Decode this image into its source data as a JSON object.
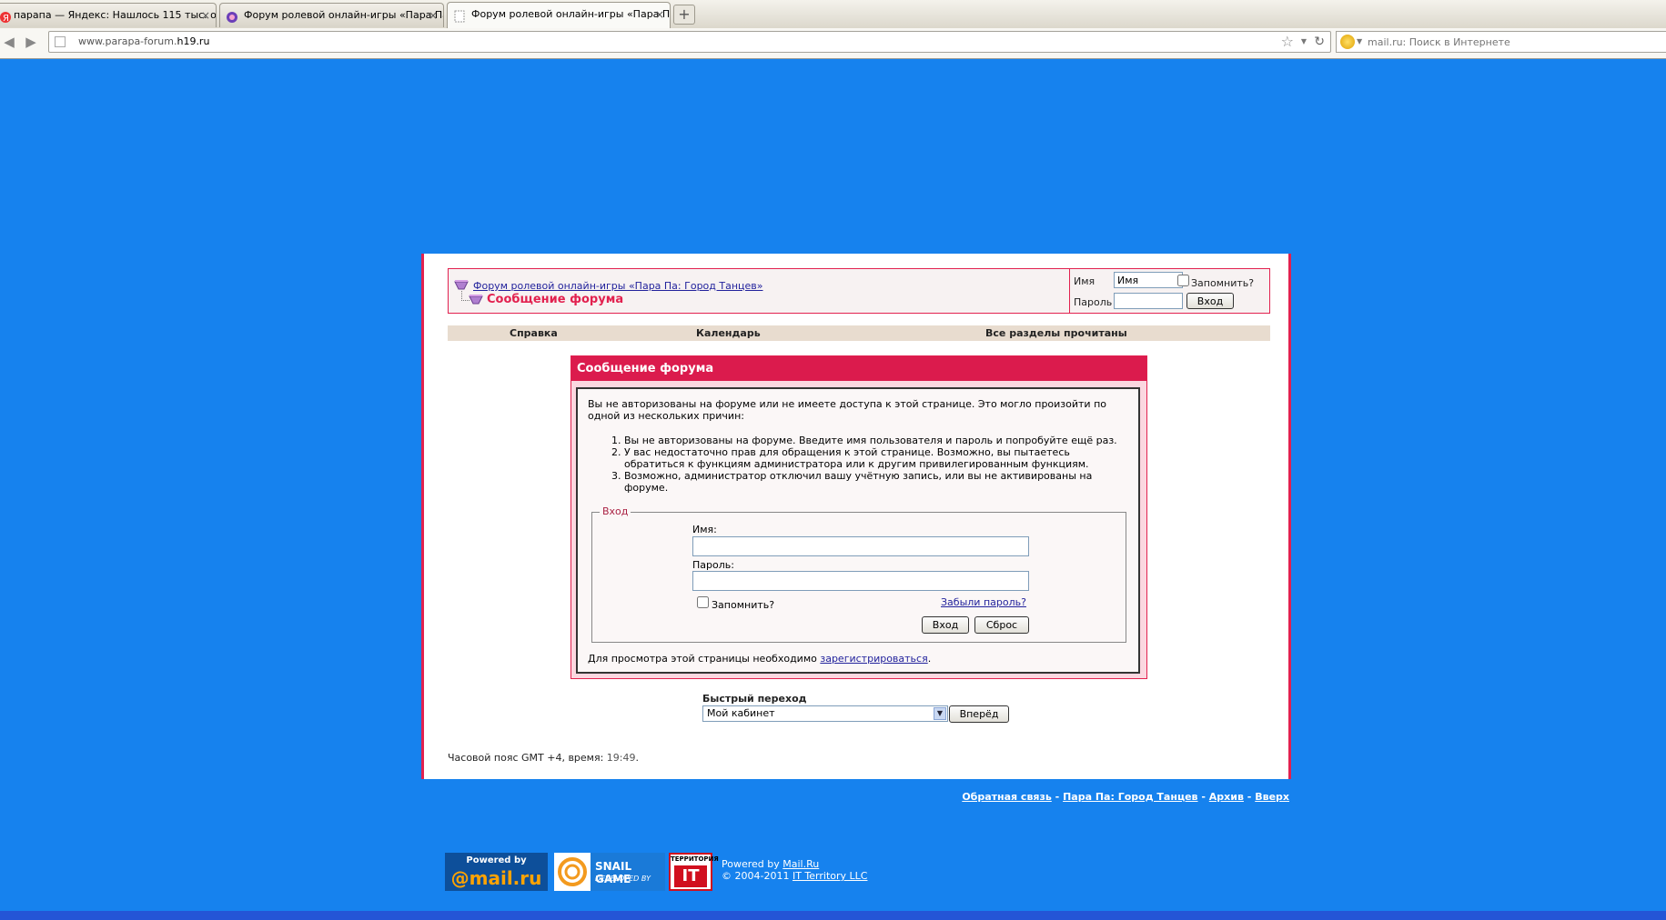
{
  "browser": {
    "tabs": [
      {
        "title": "парапа — Яндекс: Нашлось 115 тыс. о..."
      },
      {
        "title": "Форум ролевой онлайн-игры «Пара Па..."
      },
      {
        "title": "Форум ролевой онлайн-игры «Пара Па..."
      }
    ],
    "new_tab": "+",
    "url_host": "www.parapa-forum.",
    "url_domain": "h19.ru",
    "search_placeholder": "mail.ru: Поиск в Интернете"
  },
  "header": {
    "breadcrumb_link": "Форум ролевой онлайн-игры «Пара Па: Город Танцев»",
    "page_title": "Сообщение форума",
    "login": {
      "name_label": "Имя",
      "name_value": "Имя",
      "remember_label": "Запомнить?",
      "password_label": "Пароль",
      "submit_label": "Вход"
    }
  },
  "menu": {
    "items": [
      {
        "label": "Справка"
      },
      {
        "label": "Календарь"
      },
      {
        "label": "Все разделы прочитаны"
      }
    ]
  },
  "message": {
    "title": "Сообщение форума",
    "intro": "Вы не авторизованы на форуме или не имеете доступа к этой странице. Это могло произойти по одной из нескольких причин:",
    "reasons": [
      "Вы не авторизованы на форуме. Введите имя пользователя и пароль и попробуйте ещё раз.",
      "У вас недостаточно прав для обращения к этой странице. Возможно, вы пытаетесь обратиться к функциям администратора или к другим привилегированным функциям.",
      "Возможно, администратор отключил вашу учётную запись, или вы не активированы на форуме."
    ],
    "login_legend": "Вход",
    "name_label": "Имя:",
    "password_label": "Пароль:",
    "remember_label": "Запомнить?",
    "forgot_link": "Забыли пароль?",
    "submit_label": "Вход",
    "reset_label": "Сброс",
    "register_prefix": "Для просмотра этой страницы необходимо",
    "register_link": "зарегистрироваться",
    "register_suffix": "."
  },
  "quick_jump": {
    "label": "Быстрый переход",
    "selected": "Мой кабинет",
    "go_label": "Вперёд"
  },
  "timezone": {
    "label": "Часовой пояс GMT +4, время:",
    "time": "19:49",
    "suffix": "."
  },
  "footer": {
    "links": [
      "Обратная связь",
      "Пара Па: Город Танцев",
      "Архив",
      "Вверх"
    ],
    "separator": "-",
    "logos": {
      "mailru_top": "Powered by",
      "mailru_bottom": "@mail.ru",
      "snail_top": "SNAIL GAME",
      "snail_bottom": "DEVELOPED BY",
      "it_top": "ТЕРРИТОРИЯ",
      "it_bottom": "IT"
    },
    "powered_prefix": "Powered by",
    "powered_link": "Mail.Ru",
    "copyright_prefix": "© 2004-2011",
    "copyright_link": "IT Territory LLC"
  },
  "colors": {
    "background": "#1682ee",
    "accent": "#db1b4d",
    "menu_bar": "#e8dccf",
    "panel_pink": "#fbd7e0"
  }
}
